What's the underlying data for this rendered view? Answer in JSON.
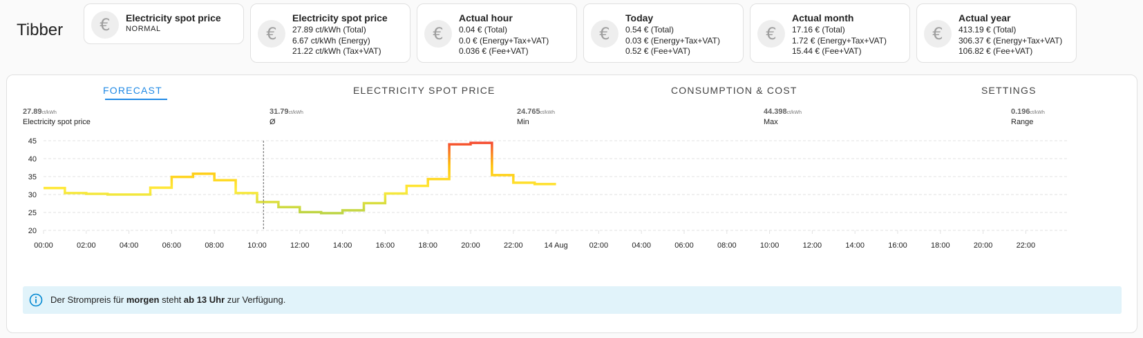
{
  "app": {
    "title": "Tibber"
  },
  "cards": [
    {
      "icon": "euro-icon",
      "title": "Electricity spot price",
      "state": "NORMAL",
      "lines": []
    },
    {
      "icon": "euro-icon",
      "title": "Electricity spot price",
      "lines": [
        "27.89 ct/kWh (Total)",
        "6.67 ct/kWh (Energy)",
        "21.22 ct/kWh (Tax+VAT)"
      ]
    },
    {
      "icon": "euro-icon",
      "title": "Actual hour",
      "lines": [
        "0.04 € (Total)",
        "0.0 € (Energy+Tax+VAT)",
        "0.036 € (Fee+VAT)"
      ]
    },
    {
      "icon": "euro-icon",
      "title": "Today",
      "lines": [
        "0.54 € (Total)",
        "0.03 € (Energy+Tax+VAT)",
        "0.52 € (Fee+VAT)"
      ]
    },
    {
      "icon": "euro-icon",
      "title": "Actual month",
      "lines": [
        "17.16 € (Total)",
        "1.72 € (Energy+Tax+VAT)",
        "15.44 € (Fee+VAT)"
      ]
    },
    {
      "icon": "euro-icon",
      "title": "Actual year",
      "lines": [
        "413.19 € (Total)",
        "306.37 € (Energy+Tax+VAT)",
        "106.82 € (Fee+VAT)"
      ]
    }
  ],
  "euro_symbol": "€",
  "tabs": [
    {
      "label": "FORECAST",
      "active": true
    },
    {
      "label": "ELECTRICITY SPOT PRICE",
      "active": false
    },
    {
      "label": "CONSUMPTION & COST",
      "active": false
    },
    {
      "label": "SETTINGS",
      "active": false
    }
  ],
  "stats": [
    {
      "value": "27.89",
      "unit": "ct/kWh",
      "label": "Electricity spot price"
    },
    {
      "value": "31.79",
      "unit": "ct/kWh",
      "label": "Ø"
    },
    {
      "value": "24.765",
      "unit": "ct/kWh",
      "label": "Min"
    },
    {
      "value": "44.398",
      "unit": "ct/kWh",
      "label": "Max"
    },
    {
      "value": "0.196",
      "unit": "ct/kWh",
      "label": "Range"
    }
  ],
  "chart_data": {
    "type": "line",
    "step": true,
    "x_tick_labels": [
      "00:00",
      "02:00",
      "04:00",
      "06:00",
      "08:00",
      "10:00",
      "12:00",
      "14:00",
      "16:00",
      "18:00",
      "20:00",
      "22:00",
      "14 Aug",
      "02:00",
      "04:00",
      "06:00",
      "08:00",
      "10:00",
      "12:00",
      "14:00",
      "16:00",
      "18:00",
      "20:00",
      "22:00"
    ],
    "y_ticks": [
      20,
      25,
      30,
      35,
      40,
      45
    ],
    "ylim": [
      20,
      45
    ],
    "x_range_hours": [
      0,
      48
    ],
    "hours": [
      0,
      1,
      2,
      3,
      4,
      5,
      6,
      7,
      8,
      9,
      10,
      11,
      12,
      13,
      14,
      15,
      16,
      17,
      18,
      19,
      20,
      21,
      22,
      23
    ],
    "values": [
      31.8,
      30.4,
      30.2,
      30.0,
      30.0,
      31.9,
      34.9,
      35.8,
      34.0,
      30.4,
      27.9,
      26.5,
      25.1,
      24.8,
      25.6,
      27.6,
      30.3,
      32.4,
      34.3,
      44.0,
      44.4,
      35.4,
      33.3,
      32.9
    ],
    "current_hour": 10.3,
    "grid": true,
    "colors": {
      "low": "#8bc34a",
      "mid": "#ffeb3b",
      "high": "#f44336",
      "now_line": "#616161",
      "grid": "#e0e0e0"
    }
  },
  "info": {
    "parts": [
      {
        "text": "Der Strompreis für ",
        "bold": false
      },
      {
        "text": "morgen",
        "bold": true
      },
      {
        "text": " steht ",
        "bold": false
      },
      {
        "text": "ab 13 Uhr",
        "bold": true
      },
      {
        "text": " zur Verfügung.",
        "bold": false
      }
    ],
    "icon": "info-circle-icon",
    "accent": "#0288d1"
  }
}
